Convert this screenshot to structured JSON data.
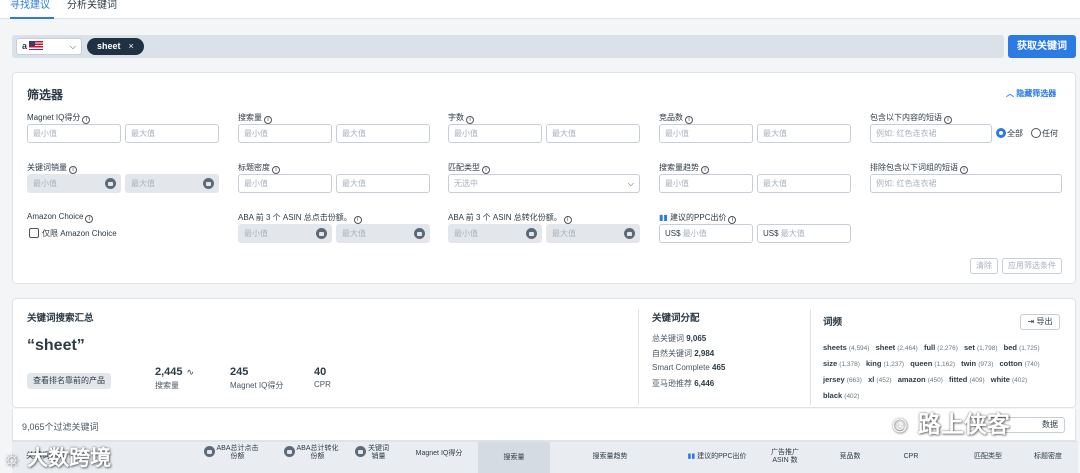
{
  "tabs": [
    {
      "label": "寻找建议",
      "active": true
    },
    {
      "label": "分析关键词",
      "active": false
    }
  ],
  "search": {
    "marketplace_logo": "a",
    "chip": "sheet",
    "chip_close": "×",
    "get_button": "获取关键词"
  },
  "filters": {
    "title": "筛选器",
    "hide_label": "隐藏筛选器",
    "clear_button": "清除",
    "apply_button": "应用筛选条件",
    "min": "最小值",
    "max": "最大值",
    "magnet_iq": "Magnet IQ得分",
    "search_volume": "搜索量",
    "word_count": "字数",
    "competing_products": "竞品数",
    "include_phrase": "包含以下内容的短语",
    "include_placeholder": "例如: 红色连衣裙",
    "radio_all": "全部",
    "radio_any": "任何",
    "keyword_sales": "关键词销量",
    "title_density": "标题密度",
    "match_type": "匹配类型",
    "match_placeholder": "无选中",
    "search_trend": "搜索量趋势",
    "exclude_phrase": "排除包含以下词组的短语",
    "exclude_placeholder": "例如: 红色连衣裙",
    "amazon_choice": "Amazon Choice",
    "amazon_choice_only": "仅限 Amazon Choice",
    "aba_click": "ABA 前 3 个 ASIN 总点击份额。",
    "aba_conv": "ABA 前 3 个 ASIN 总转化份额。",
    "ppc": "建议的PPC出价",
    "currency": "US$"
  },
  "summary": {
    "title": "关键词搜索汇总",
    "keyword": "“sheet”",
    "view_button": "查看排名靠前的产品",
    "search_volume": "2,445",
    "search_volume_label": "搜索量",
    "magnet_iq": "245",
    "magnet_iq_label": "Magnet IQ得分",
    "cpr": "40",
    "cpr_label": "CPR",
    "dist_title": "关键词分配",
    "dist": [
      {
        "k": "总关键词",
        "v": "9,065"
      },
      {
        "k": "自然关键词",
        "v": "2,984"
      },
      {
        "k": "Smart Complete",
        "v": "465"
      },
      {
        "k": "亚马逊推荐",
        "v": "6,446"
      }
    ],
    "freq_title": "词频",
    "export_button": "导出",
    "freq": [
      {
        "w": "sheets",
        "c": "(4,594)"
      },
      {
        "w": "sheet",
        "c": "(2,464)"
      },
      {
        "w": "full",
        "c": "(2,276)"
      },
      {
        "w": "set",
        "c": "(1,798)"
      },
      {
        "w": "bed",
        "c": "(1,725)"
      },
      {
        "w": "size",
        "c": "(1,378)"
      },
      {
        "w": "king",
        "c": "(1,237)"
      },
      {
        "w": "queen",
        "c": "(1,162)"
      },
      {
        "w": "twin",
        "c": "(973)"
      },
      {
        "w": "cotton",
        "c": "(740)"
      },
      {
        "w": "jersey",
        "c": "(663)"
      },
      {
        "w": "xl",
        "c": "(452)"
      },
      {
        "w": "amazon",
        "c": "(450)"
      },
      {
        "w": "fitted",
        "c": "(409)"
      },
      {
        "w": "white",
        "c": "(402)"
      },
      {
        "w": "black",
        "c": "(402)"
      }
    ],
    "filtered_count": "9,065个过滤关键词",
    "data_label": "数据"
  },
  "table": {
    "headers": [
      "关键词词组",
      "ABA总计点击份额",
      "ABA总计转化份额",
      "关键词销量",
      "Magnet IQ得分",
      "搜索量",
      "搜索量趋势",
      "建议的PPC出价",
      "广告推广ASIN 数",
      "竞品数",
      "CPR",
      "匹配类型",
      "标题密度"
    ]
  },
  "watermark": {
    "left": "大数跨境",
    "right": "路上侠客"
  },
  "colors": {
    "accent": "#2c7be5",
    "chip": "#1f3143"
  }
}
